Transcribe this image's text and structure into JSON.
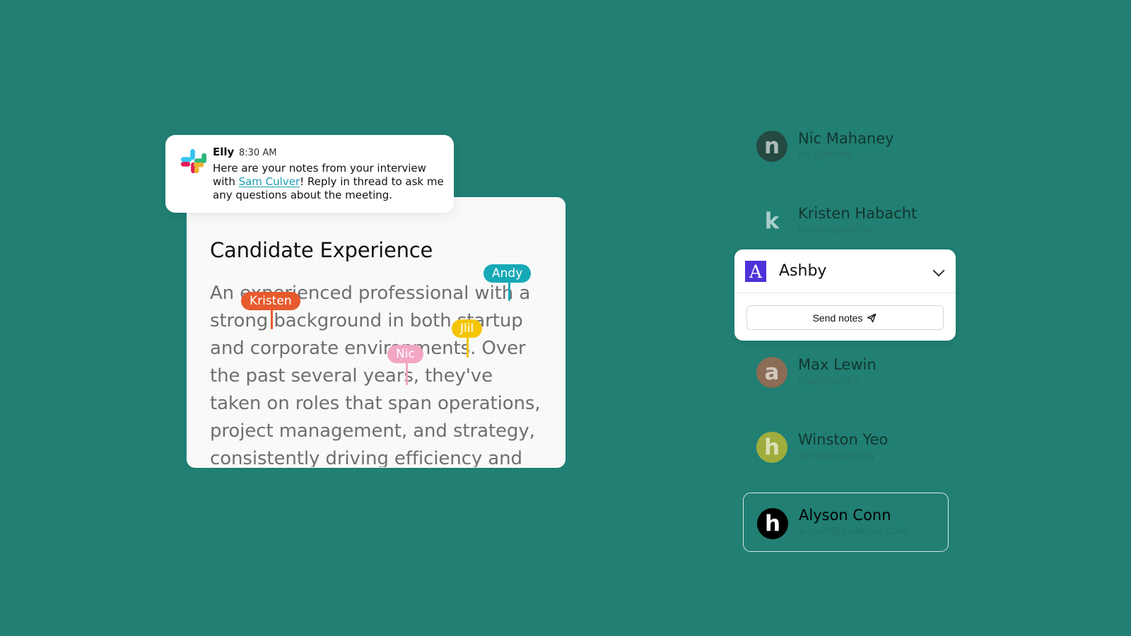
{
  "slack": {
    "sender": "Elly",
    "time": "8:30 AM",
    "message_before_link": "Here are your notes from your interview with ",
    "link_text": "Sam Culver",
    "message_after_link": "! Reply in thread to ask me any questions about the meeting."
  },
  "document": {
    "title": "Candidate Experience",
    "body": "An experienced professional with a strong background in both startup and corporate environments. Over the past several years, they've taken on roles that span operations, project management, and strategy, consistently driving efficiency and"
  },
  "collaborators": [
    {
      "name": "Andy",
      "color": "#17a9b6"
    },
    {
      "name": "Kristen",
      "color": "#e65a2d"
    },
    {
      "name": "Jlil",
      "color": "#f4c500"
    },
    {
      "name": "Nic",
      "color": "#f2a6c3"
    }
  ],
  "people": [
    {
      "initial": "n",
      "name": "Nic Mahaney",
      "email": "nic@ashby",
      "avatar_color": "#244a42"
    },
    {
      "initial": "k",
      "name": "Kristen Habacht",
      "email": "kristen@ashby",
      "avatar_color": "#217f73"
    },
    {
      "initial": "a",
      "name": "Max Lewin",
      "email": "max@ashby",
      "avatar_color": "#8b6c56"
    },
    {
      "initial": "h",
      "name": "Winston Yeo",
      "email": "winston@ashby",
      "avatar_color": "#9ead3d"
    },
    {
      "initial": "h",
      "name": "Alyson Conn",
      "email": "alyson@example.com",
      "avatar_color": "#000000"
    }
  ],
  "ashby": {
    "logo_text": "A",
    "name": "Ashby",
    "send_label": "Send notes"
  }
}
